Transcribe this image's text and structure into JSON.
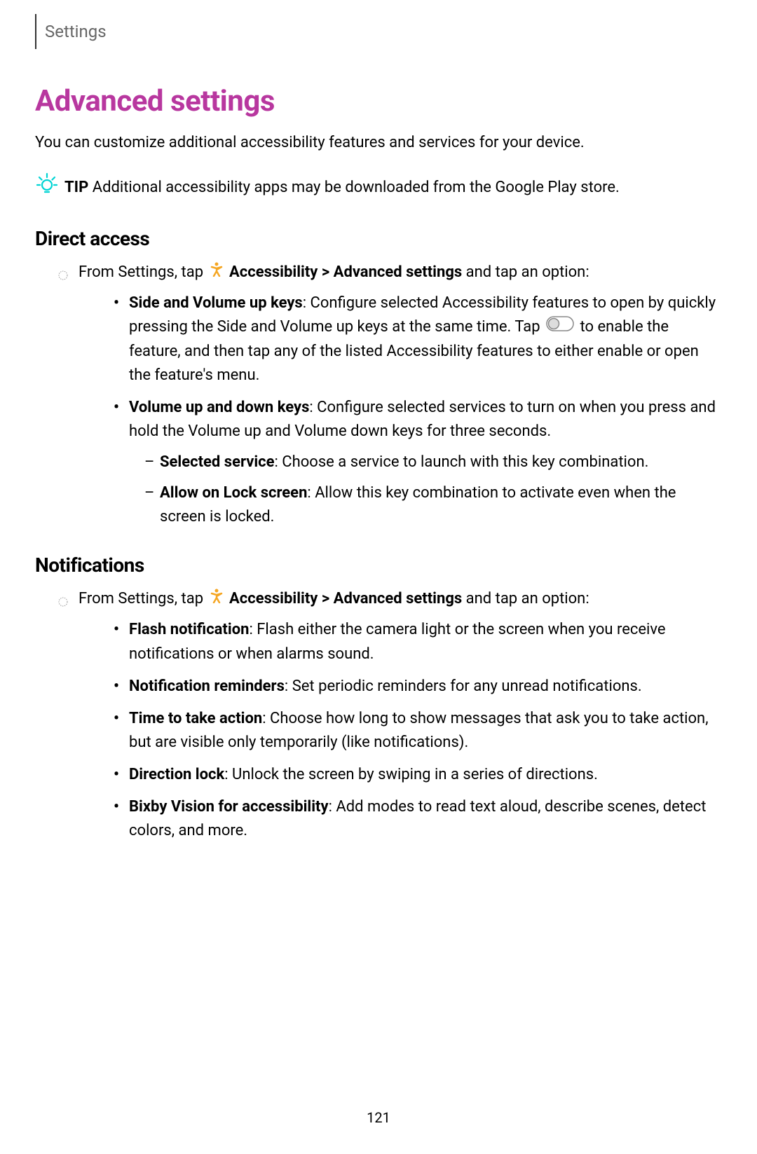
{
  "header": {
    "section": "Settings"
  },
  "title": "Advanced settings",
  "intro": "You can customize additional accessibility features and services for your device.",
  "tip": {
    "label": "TIP",
    "text": "Additional accessibility apps may be downloaded from the Google Play store."
  },
  "sections": [
    {
      "heading": "Direct access",
      "instruction_prefix": "From Settings, tap ",
      "instruction_path_bold1": "Accessibility",
      "instruction_separator": " > ",
      "instruction_path_bold2": "Advanced settings",
      "instruction_suffix": " and tap an option:",
      "bullets": [
        {
          "bold": "Side and Volume up keys",
          "text_before_toggle": ": Configure selected Accessibility features to open by quickly pressing the Side and Volume up keys at the same time. Tap ",
          "text_after_toggle": " to enable the feature, and then tap any of the listed Accessibility features to either enable or open the feature's menu.",
          "has_toggle": true
        },
        {
          "bold": "Volume up and down keys",
          "text": ": Configure selected services to turn on when you press and hold the Volume up and Volume down keys for three seconds.",
          "sub": [
            {
              "bold": "Selected service",
              "text": ": Choose a service to launch with this key combination."
            },
            {
              "bold": "Allow on Lock screen",
              "text": ": Allow this key combination to activate even when the screen is locked."
            }
          ]
        }
      ]
    },
    {
      "heading": "Notifications",
      "instruction_prefix": "From Settings, tap ",
      "instruction_path_bold1": "Accessibility",
      "instruction_separator": " > ",
      "instruction_path_bold2": "Advanced settings",
      "instruction_suffix": " and tap an option:",
      "bullets": [
        {
          "bold": "Flash notification",
          "text": ": Flash either the camera light or the screen when you receive notifications or when alarms sound."
        },
        {
          "bold": "Notification reminders",
          "text": ": Set periodic reminders for any unread notifications."
        },
        {
          "bold": "Time to take action",
          "text": ": Choose how long to show messages that ask you to take action, but are visible only temporarily (like notifications)."
        },
        {
          "bold": "Direction lock",
          "text": ": Unlock the screen by swiping in a series of directions."
        },
        {
          "bold": "Bixby Vision for accessibility",
          "text": ": Add modes to read text aloud, describe scenes, detect colors, and more."
        }
      ]
    }
  ],
  "page_number": "121"
}
